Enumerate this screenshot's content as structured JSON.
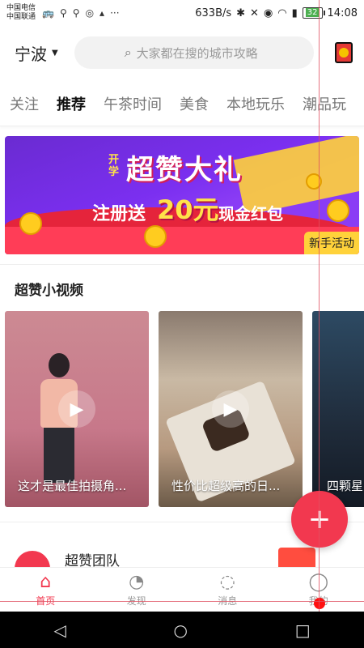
{
  "status": {
    "carrier1": "中国电信",
    "carrier2": "中国联通",
    "speed": "633B/s",
    "battery": "32",
    "time": "14:08"
  },
  "header": {
    "city": "宁波",
    "search_placeholder": "大家都在搜的城市攻略"
  },
  "tabs": [
    "关注",
    "推荐",
    "午茶时间",
    "美食",
    "本地玩乐",
    "潮品玩"
  ],
  "banner": {
    "tag": "开学",
    "title": "超赞大礼",
    "line_a": "注册送",
    "amount": "20元",
    "line_b": "现金红包",
    "badge": "新手活动"
  },
  "section": {
    "title": "超赞小视频"
  },
  "videos": [
    {
      "caption": "这才是最佳拍摄角..."
    },
    {
      "caption": "性价比超级高的日..."
    },
    {
      "caption": "四颗星"
    }
  ],
  "team": {
    "name": "超赞团队"
  },
  "bottom_nav": [
    {
      "label": "首页",
      "icon": "home-icon"
    },
    {
      "label": "发现",
      "icon": "compass-icon"
    },
    {
      "label": "消息",
      "icon": "message-icon"
    },
    {
      "label": "我的",
      "icon": "user-icon"
    }
  ],
  "colors": {
    "accent": "#f2384f",
    "banner_purple": "#7b2ff0",
    "banner_yellow": "#ffd23a"
  }
}
